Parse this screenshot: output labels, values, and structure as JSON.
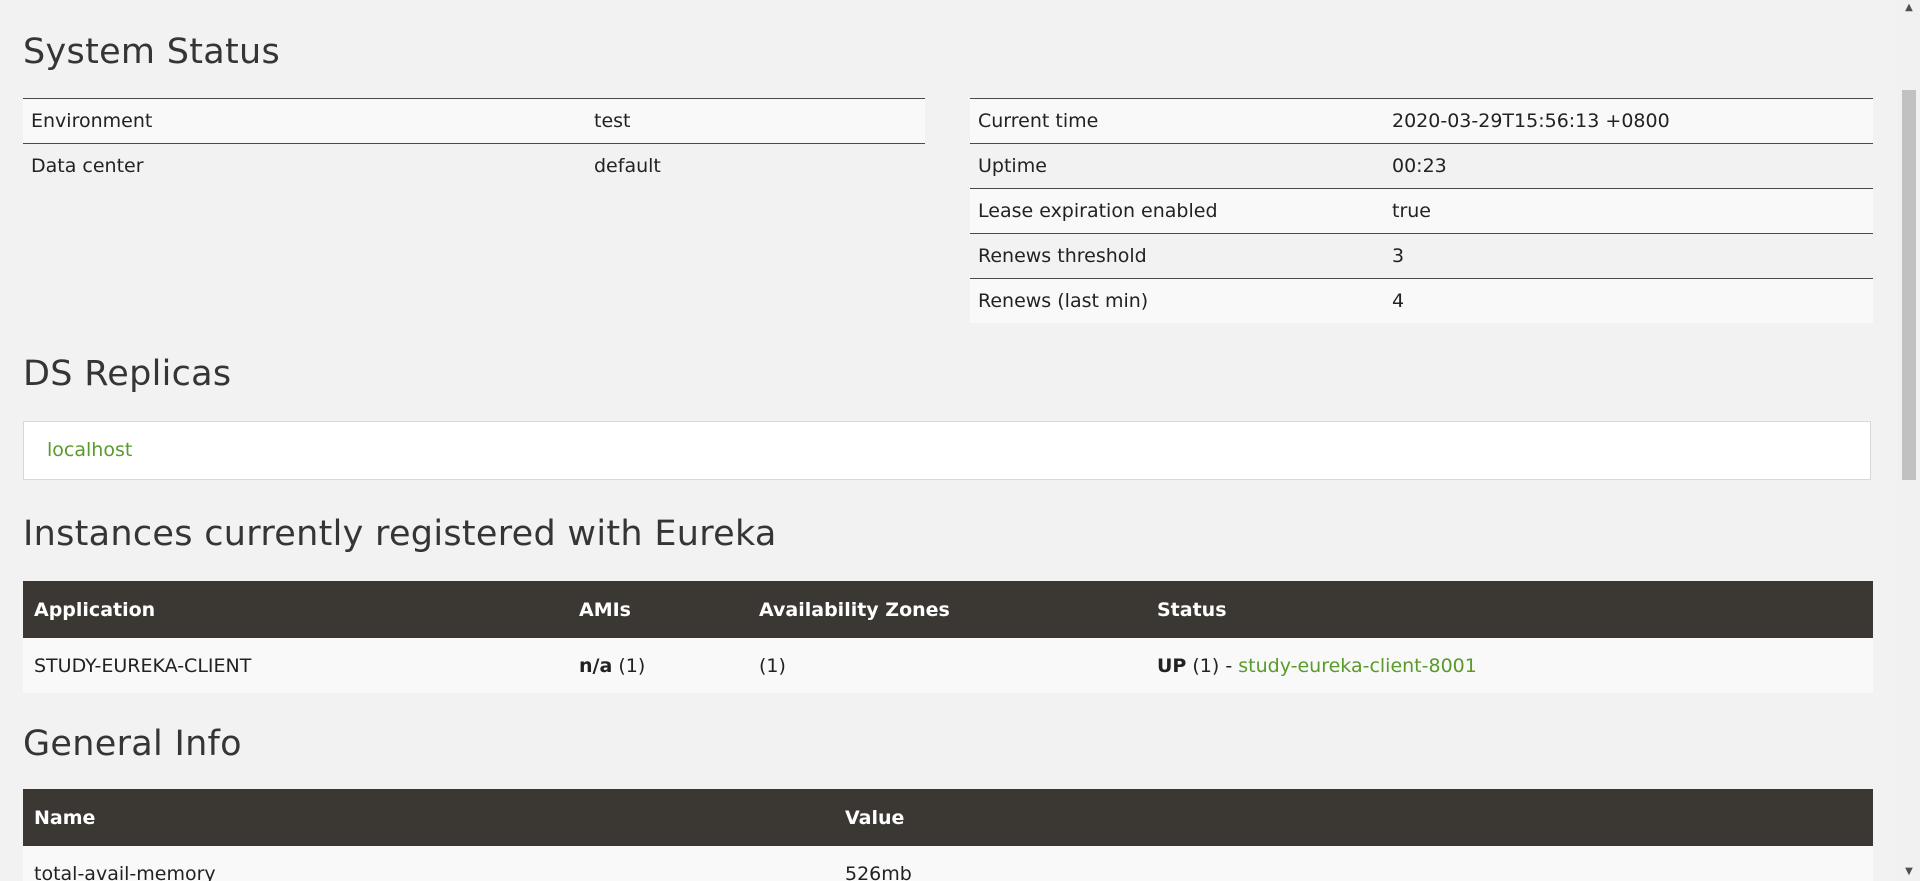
{
  "system_status": {
    "title": "System Status",
    "left_rows": [
      {
        "label": "Environment",
        "value": "test"
      },
      {
        "label": "Data center",
        "value": "default"
      }
    ],
    "right_rows": [
      {
        "label": "Current time",
        "value": "2020-03-29T15:56:13 +0800"
      },
      {
        "label": "Uptime",
        "value": "00:23"
      },
      {
        "label": "Lease expiration enabled",
        "value": "true"
      },
      {
        "label": "Renews threshold",
        "value": "3"
      },
      {
        "label": "Renews (last min)",
        "value": "4"
      }
    ]
  },
  "ds_replicas": {
    "title": "DS Replicas",
    "link": "localhost"
  },
  "instances": {
    "title": "Instances currently registered with Eureka",
    "headers": [
      "Application",
      "AMIs",
      "Availability Zones",
      "Status"
    ],
    "rows": [
      {
        "application": "STUDY-EUREKA-CLIENT",
        "amis_bold": "n/a",
        "amis_count": " (1)",
        "zones": "(1)",
        "status_bold": "UP",
        "status_count": " (1) - ",
        "status_link": "study-eureka-client-8001"
      }
    ]
  },
  "general_info": {
    "title": "General Info",
    "headers": [
      "Name",
      "Value"
    ],
    "rows": [
      {
        "name": "total-avail-memory",
        "value": "526mb"
      }
    ]
  },
  "icons": {
    "scroll_up": "▲",
    "scroll_down": "▼"
  }
}
